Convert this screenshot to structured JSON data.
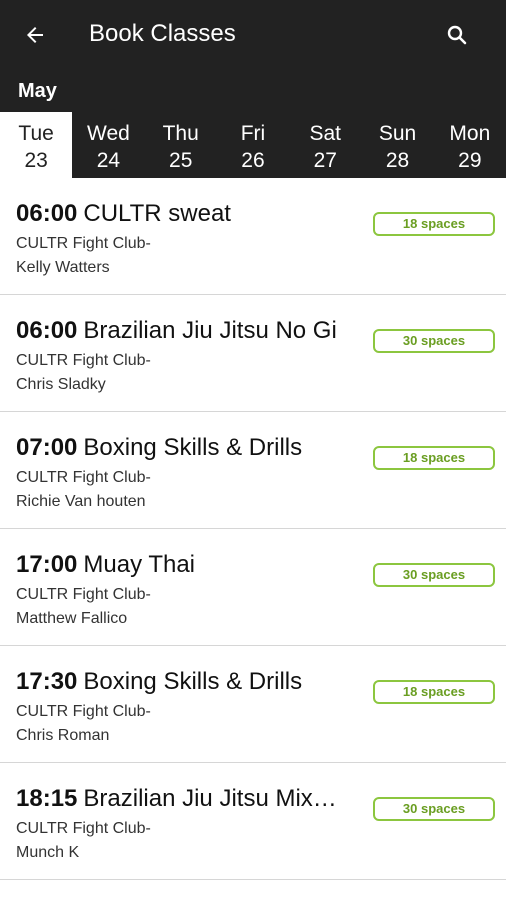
{
  "header": {
    "title": "Book Classes",
    "back_icon": "arrow-left-icon",
    "search_icon": "search-icon"
  },
  "calendar": {
    "month": "May",
    "days": [
      {
        "dow": "Tue",
        "date": "23",
        "selected": true
      },
      {
        "dow": "Wed",
        "date": "24"
      },
      {
        "dow": "Thu",
        "date": "25"
      },
      {
        "dow": "Fri",
        "date": "26"
      },
      {
        "dow": "Sat",
        "date": "27"
      },
      {
        "dow": "Sun",
        "date": "28"
      },
      {
        "dow": "Mon",
        "date": "29"
      }
    ]
  },
  "classes": [
    {
      "time": "06:00",
      "name": "CULTR sweat",
      "club": "CULTR Fight Club-",
      "coach": "Kelly Watters",
      "spaces": "18 spaces"
    },
    {
      "time": "06:00",
      "name": "Brazilian Jiu Jitsu No Gi",
      "club": "CULTR Fight Club-",
      "coach": "Chris Sladky",
      "spaces": "30 spaces"
    },
    {
      "time": "07:00",
      "name": "Boxing Skills & Drills",
      "club": "CULTR Fight Club-",
      "coach": "Richie Van houten",
      "spaces": "18 spaces"
    },
    {
      "time": "17:00",
      "name": "Muay Thai",
      "club": "CULTR Fight Club-",
      "coach": "Matthew Fallico",
      "spaces": "30 spaces"
    },
    {
      "time": "17:30",
      "name": "Boxing Skills & Drills",
      "club": "CULTR Fight Club-",
      "coach": "Chris Roman",
      "spaces": "18 spaces"
    },
    {
      "time": "18:15",
      "name": "Brazilian Jiu Jitsu Mix…",
      "club": "CULTR Fight Club-",
      "coach": "Munch K",
      "spaces": "30 spaces"
    }
  ],
  "colors": {
    "header_bg": "#222222",
    "badge": "#8cc63f"
  }
}
